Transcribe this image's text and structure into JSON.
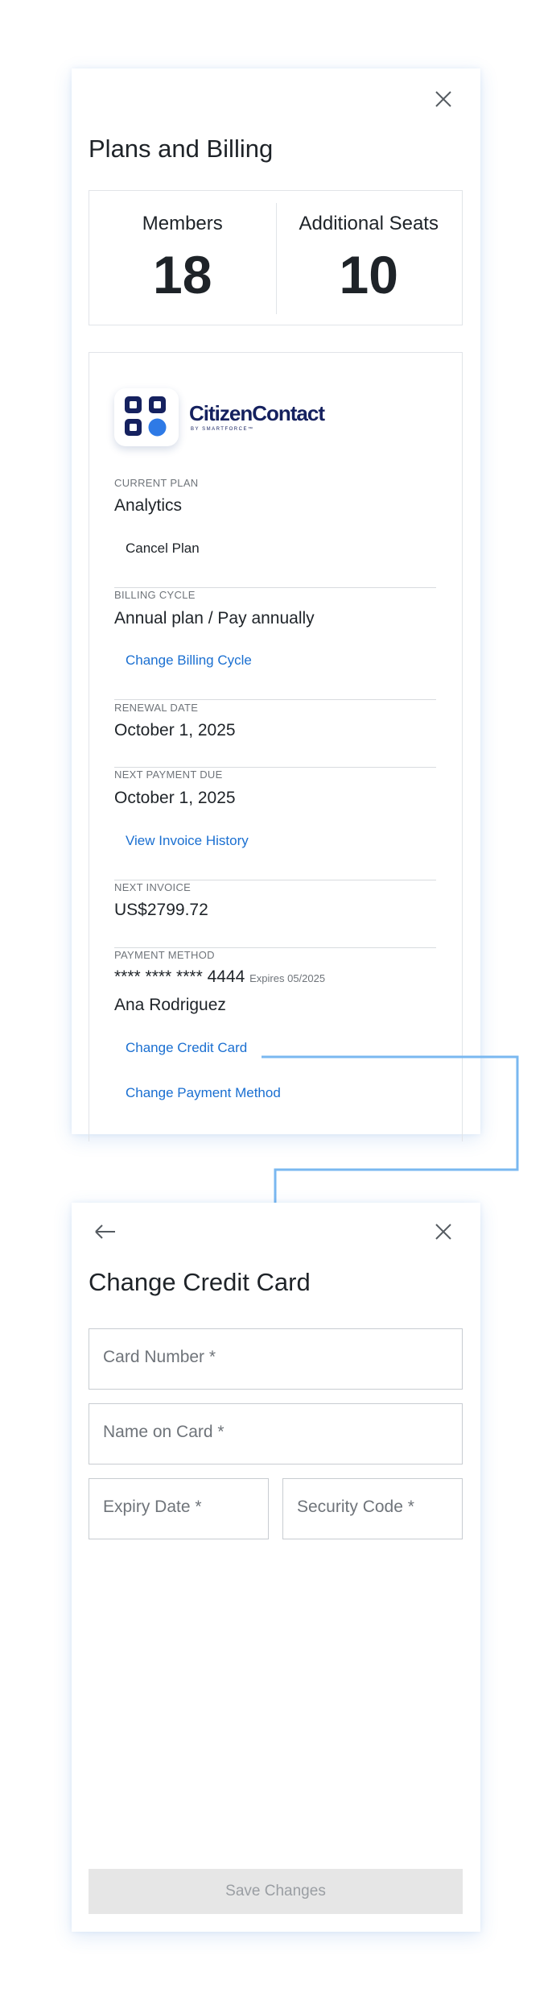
{
  "plans_panel": {
    "title": "Plans and Billing",
    "close_icon": "close-icon",
    "stats": {
      "members_label": "Members",
      "members_value": "18",
      "seats_label": "Additional Seats",
      "seats_value": "10"
    },
    "logo": {
      "name": "CitizenContact",
      "tagline": "BY SMARTFORCE™",
      "colors": {
        "navy": "#15215f",
        "blue": "#2e7ae6"
      }
    },
    "current_plan": {
      "label": "CURRENT PLAN",
      "value": "Analytics",
      "action": "Cancel Plan"
    },
    "billing_cycle": {
      "label": "BILLING CYCLE",
      "value": "Annual plan / Pay annually",
      "action": "Change Billing Cycle"
    },
    "renewal_date": {
      "label": "RENEWAL DATE",
      "value": "October 1, 2025"
    },
    "next_payment": {
      "label": "NEXT PAYMENT DUE",
      "value": "October 1, 2025",
      "action": "View Invoice History"
    },
    "next_invoice": {
      "label": "NEXT INVOICE",
      "value": "US$2799.72"
    },
    "payment_method": {
      "label": "PAYMENT METHOD",
      "card_mask": "**** **** **** 4444",
      "expires": "Expires 05/2025",
      "holder": "Ana Rodriguez",
      "change_card": "Change Credit Card",
      "change_method": "Change Payment Method"
    }
  },
  "card_panel": {
    "title": "Change Credit Card",
    "back_icon": "arrow-left-icon",
    "close_icon": "close-icon",
    "fields": {
      "card_number": "Card Number *",
      "name_on_card": "Name on Card *",
      "expiry_date": "Expiry Date *",
      "security_code": "Security Code *"
    },
    "save_label": "Save Changes"
  },
  "colors": {
    "accent": "#1a6fd1",
    "connector": "#7ab8f0",
    "disabled_bg": "#e6e6e6",
    "disabled_text": "#9a9ea3"
  }
}
